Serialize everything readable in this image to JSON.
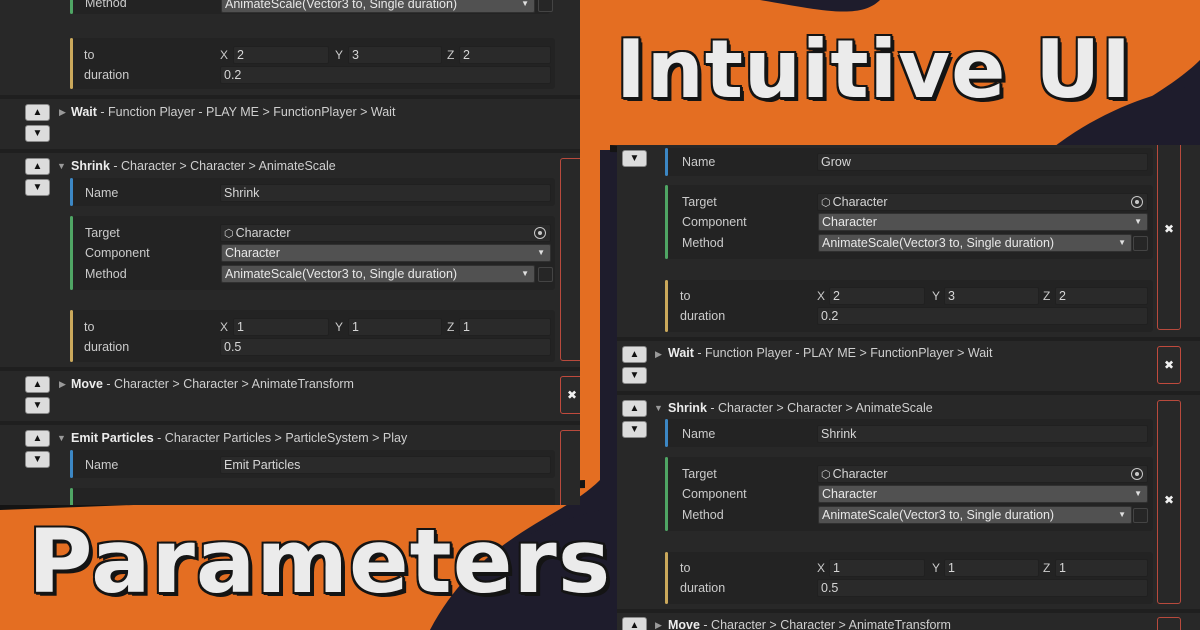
{
  "colors": {
    "accent_orange": "#e46e22",
    "background_navy": "#1e1c2c",
    "panel": "#282828",
    "group_bar_blue": "#3c87c4",
    "group_bar_green": "#4fa564",
    "group_bar_yellow": "#caa85b",
    "delete_red": "#c04a3d"
  },
  "titles": {
    "top": "Intuitive UI",
    "bottom": "Parameters"
  },
  "icons": {
    "move_up": "▲",
    "move_down": "▼",
    "foldout": "▶",
    "foldout_open": "▼",
    "dropdown": "▼",
    "delete": "✖",
    "object_field": "⬡"
  },
  "left_panel": {
    "top_partial": {
      "method_label": "Method",
      "method_value": "AnimateScale(Vector3 to, Single duration)",
      "to_label": "to",
      "to": {
        "x_label": "X",
        "x": "2",
        "y_label": "Y",
        "y": "3",
        "z_label": "Z",
        "z": "2"
      },
      "duration_label": "duration",
      "duration": "0.2"
    },
    "wait": {
      "name": "Wait",
      "path": " - Function Player - PLAY ME > FunctionPlayer > Wait"
    },
    "shrink": {
      "name": "Shrink",
      "path": " - Character > Character > AnimateScale",
      "name_label": "Name",
      "name_value": "Shrink",
      "target_label": "Target",
      "target_value": "Character",
      "component_label": "Component",
      "component_value": "Character",
      "method_label": "Method",
      "method_value": "AnimateScale(Vector3 to, Single duration)",
      "to_label": "to",
      "to": {
        "x_label": "X",
        "x": "1",
        "y_label": "Y",
        "y": "1",
        "z_label": "Z",
        "z": "1"
      },
      "duration_label": "duration",
      "duration": "0.5"
    },
    "move": {
      "name": "Move",
      "path": " - Character > Character > AnimateTransform"
    },
    "emit": {
      "name": "Emit Particles",
      "path": " - Character Particles > ParticleSystem > Play",
      "name_label": "Name",
      "name_value": "Emit Particles"
    }
  },
  "right_panel": {
    "grow": {
      "name_label": "Name",
      "name_value": "Grow",
      "target_label": "Target",
      "target_value": "Character",
      "component_label": "Component",
      "component_value": "Character",
      "method_label": "Method",
      "method_value": "AnimateScale(Vector3 to, Single duration)",
      "to_label": "to",
      "to": {
        "x_label": "X",
        "x": "2",
        "y_label": "Y",
        "y": "3",
        "z_label": "Z",
        "z": "2"
      },
      "duration_label": "duration",
      "duration": "0.2"
    },
    "wait": {
      "name": "Wait",
      "path": " - Function Player - PLAY ME > FunctionPlayer > Wait"
    },
    "shrink": {
      "name": "Shrink",
      "path": " - Character > Character > AnimateScale",
      "name_label": "Name",
      "name_value": "Shrink",
      "target_label": "Target",
      "target_value": "Character",
      "component_label": "Component",
      "component_value": "Character",
      "method_label": "Method",
      "method_value": "AnimateScale(Vector3 to, Single duration)",
      "to_label": "to",
      "to": {
        "x_label": "X",
        "x": "1",
        "y_label": "Y",
        "y": "1",
        "z_label": "Z",
        "z": "1"
      },
      "duration_label": "duration",
      "duration": "0.5"
    },
    "move": {
      "name": "Move",
      "path": " - Character > Character > AnimateTransform"
    }
  }
}
